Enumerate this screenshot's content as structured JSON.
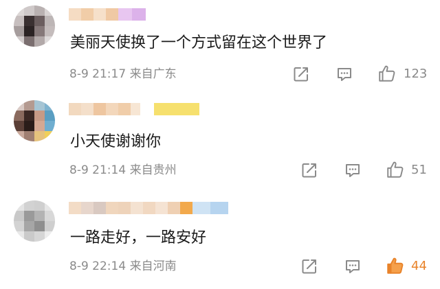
{
  "comments": [
    {
      "text": "美丽天使换了一个方式留在这个世界了",
      "time": "8-9 21:17",
      "location": "来自广东",
      "likes": "123",
      "liked": false
    },
    {
      "text": "小天使谢谢你",
      "time": "8-9 21:14",
      "location": "来自贵州",
      "likes": "51",
      "liked": false
    },
    {
      "text": "一路走好，一路安好",
      "time": "8-9 22:14",
      "location": "来自河南",
      "likes": "44",
      "liked": true
    }
  ],
  "colors": {
    "text": "#1a1a1a",
    "meta": "#8a8a8a",
    "like_active": "#e8832a",
    "icon": "#8a8a8a"
  },
  "icons": {
    "share": "share-icon",
    "comment": "comment-icon",
    "like": "thumbs-up-icon"
  }
}
